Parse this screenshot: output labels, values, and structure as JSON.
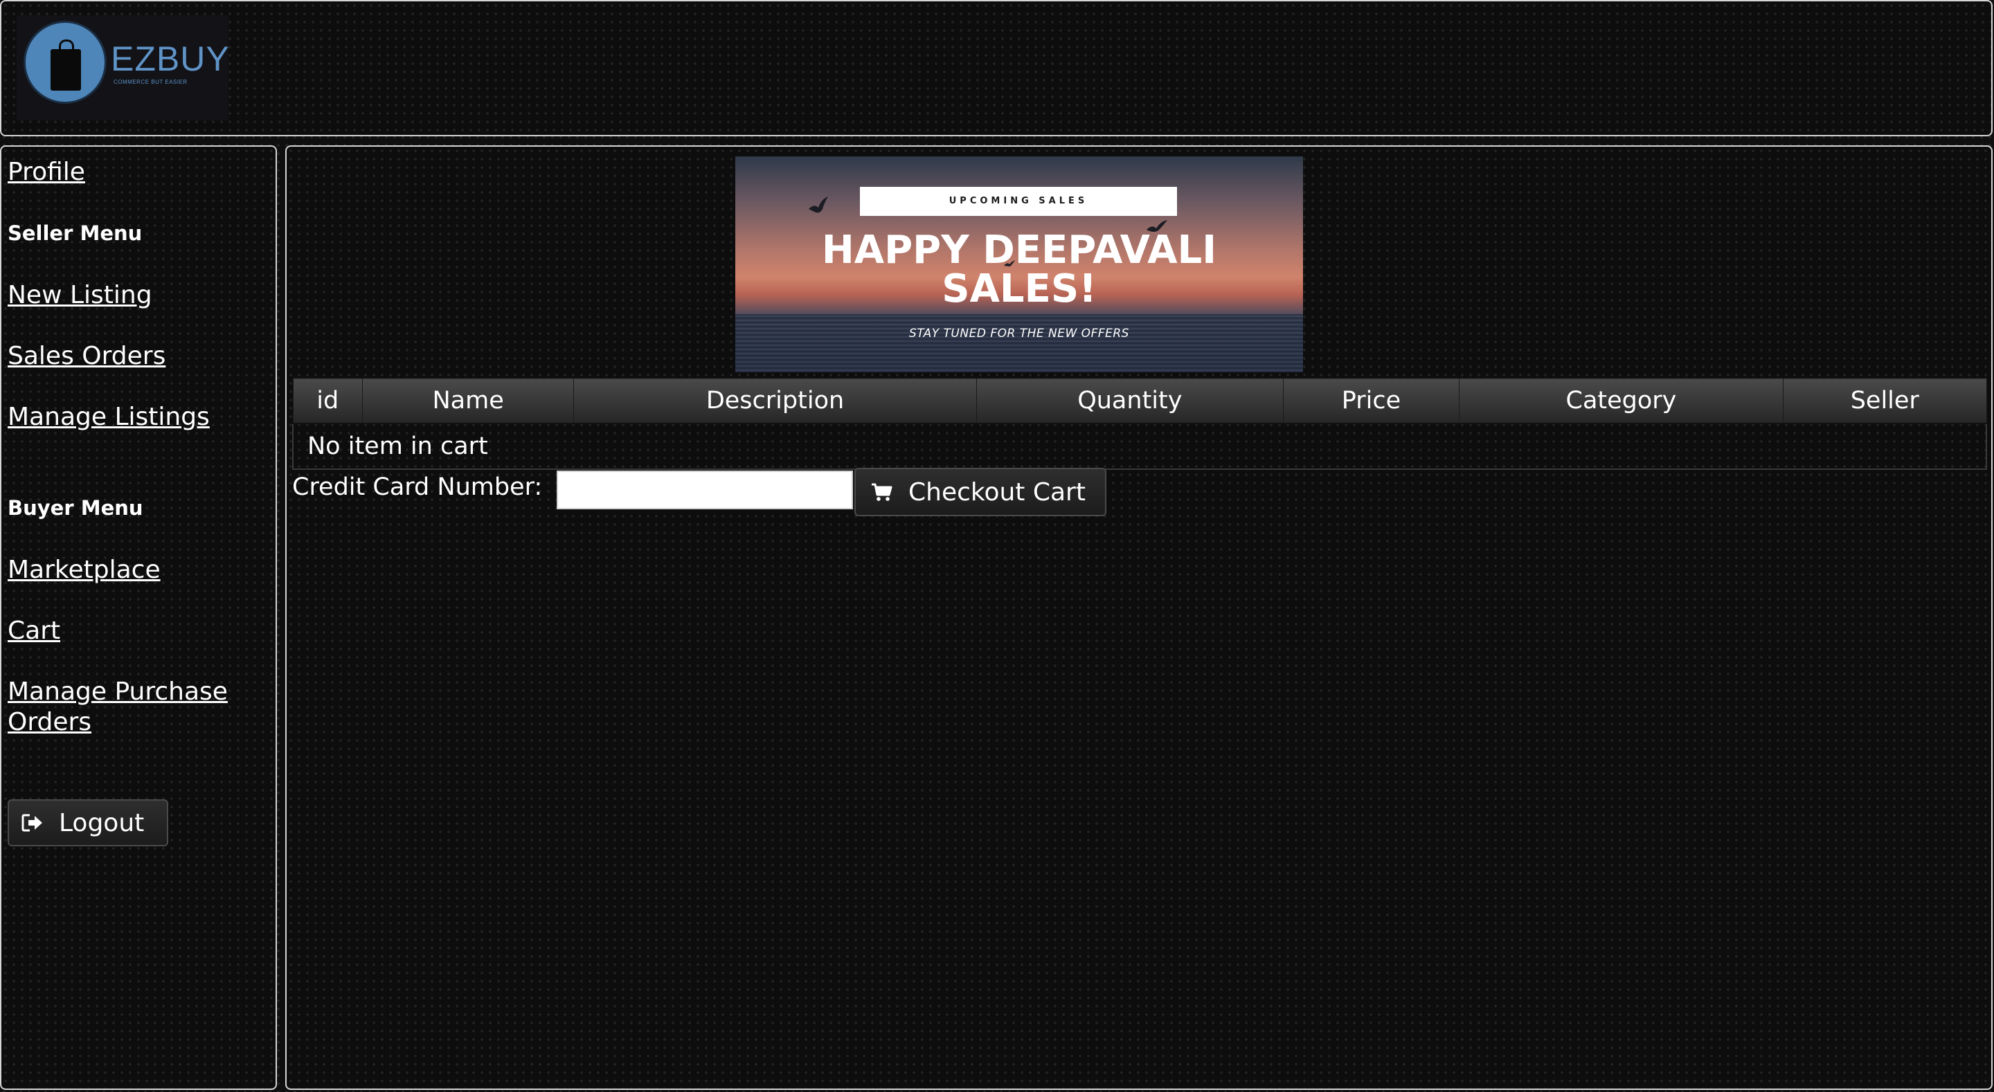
{
  "brand": {
    "name": "EZBUY",
    "tagline": "COMMERCE BUT EASIER"
  },
  "sidebar": {
    "profile_label": "Profile",
    "seller_heading": "Seller Menu",
    "seller_items": [
      {
        "label": "New Listing"
      },
      {
        "label": "Sales Orders"
      },
      {
        "label": "Manage Listings"
      }
    ],
    "buyer_heading": "Buyer Menu",
    "buyer_items": [
      {
        "label": "Marketplace"
      },
      {
        "label": "Cart"
      },
      {
        "label": "Manage Purchase Orders"
      }
    ],
    "logout_label": "Logout",
    "logout_icon": "sign-out-icon"
  },
  "banner": {
    "tag": "UPCOMING SALES",
    "title_line1": "HAPPY DEEPAVALI",
    "title_line2": "SALES!",
    "subtitle": "STAY TUNED FOR THE NEW OFFERS"
  },
  "cart": {
    "columns": [
      "id",
      "Name",
      "Description",
      "Quantity",
      "Price",
      "Category",
      "Seller"
    ],
    "empty_message": "No item in cart"
  },
  "checkout": {
    "cc_label": "Credit Card Number:",
    "cc_value": "",
    "button_label": "Checkout Cart",
    "button_icon": "shopping-cart-icon"
  },
  "colors": {
    "background": "#0f0f0f",
    "panel_border": "#d6d6d6",
    "brand_blue": "#4f86b9",
    "text": "#ffffff"
  }
}
